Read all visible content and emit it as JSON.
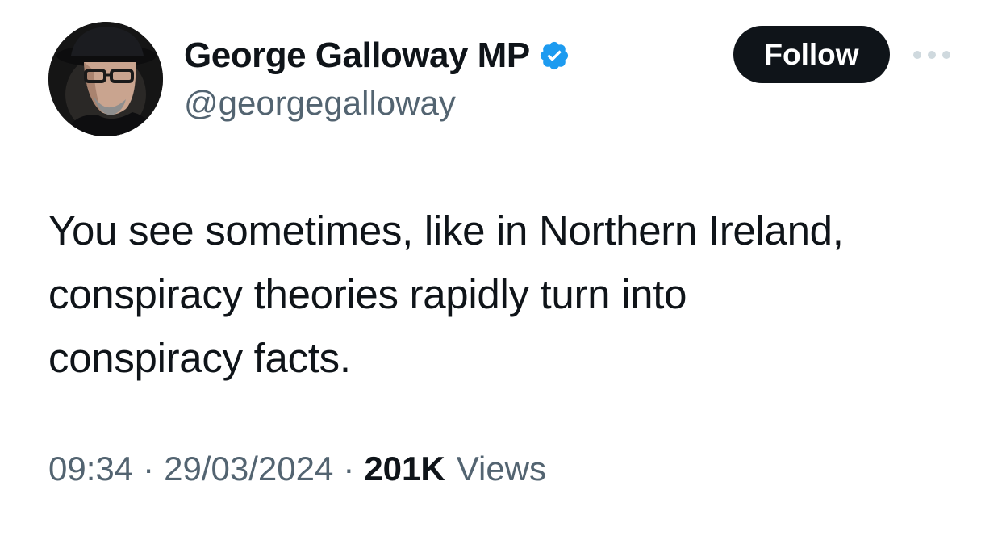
{
  "author": {
    "display_name": "George Galloway MP",
    "handle": "@georgegalloway",
    "verified": true,
    "avatar_icon": "profile-photo"
  },
  "actions": {
    "follow_label": "Follow",
    "more_icon": "more-horizontal-icon"
  },
  "tweet": {
    "lines": [
      "You see sometimes, like in Northern Ireland,",
      "conspiracy theories rapidly turn into",
      "conspiracy facts."
    ]
  },
  "meta": {
    "time": "09:34",
    "separator": "·",
    "date": "29/03/2024",
    "views_count": "201K",
    "views_label": "Views"
  },
  "colors": {
    "text_primary": "#0f1419",
    "text_secondary": "#536471",
    "verified_blue": "#1d9bf0",
    "button_bg": "#0f1419",
    "divider": "#cfd9de"
  }
}
